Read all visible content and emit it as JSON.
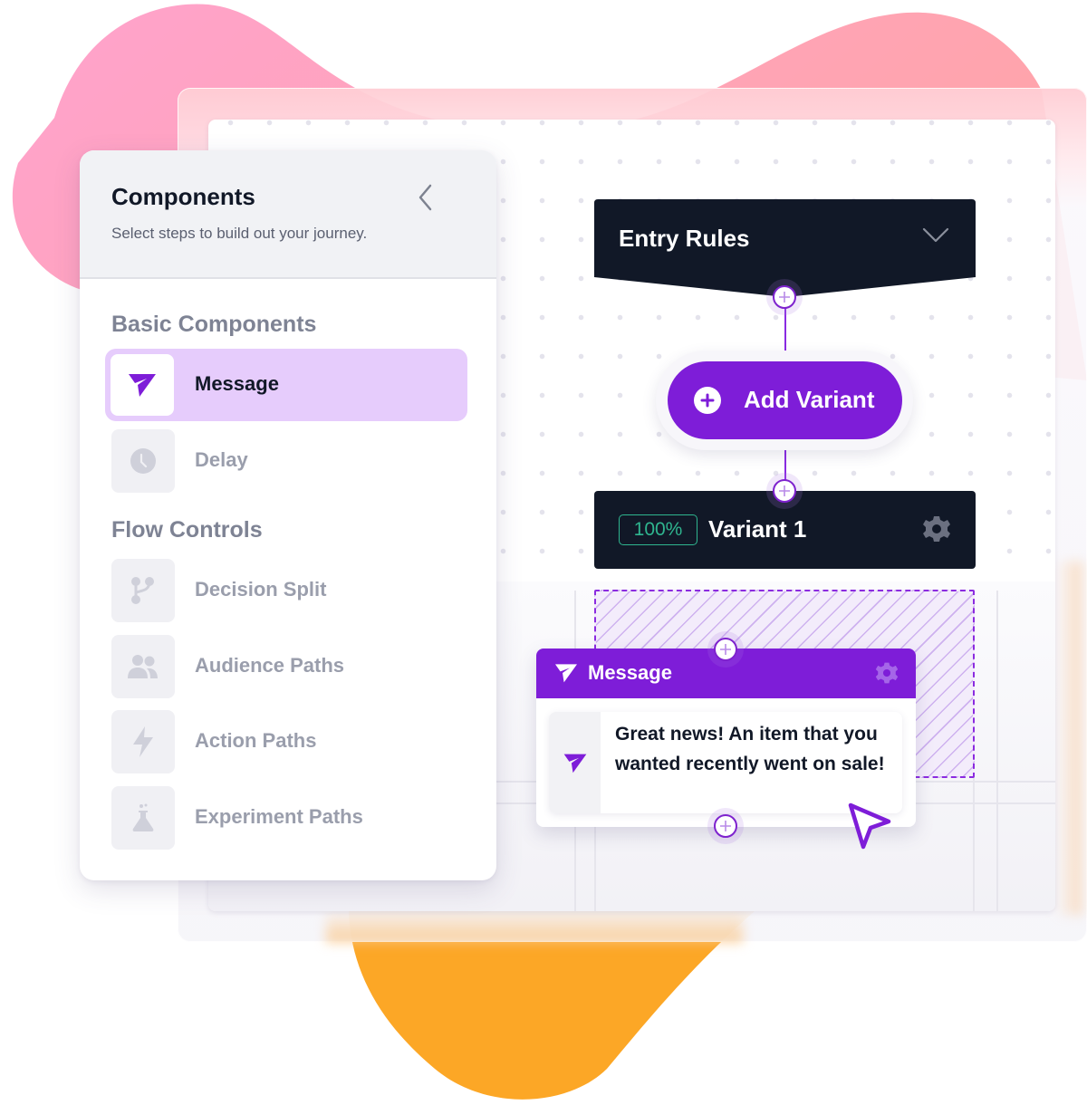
{
  "panel": {
    "title": "Components",
    "subtitle": "Select steps to build out your journey.",
    "collapse_icon": "chevron-left-icon",
    "sections": [
      {
        "title": "Basic Components",
        "items": [
          {
            "label": "Message",
            "icon": "send-icon",
            "active": true
          },
          {
            "label": "Delay",
            "icon": "clock-icon",
            "active": false
          }
        ]
      },
      {
        "title": "Flow Controls",
        "items": [
          {
            "label": "Decision Split",
            "icon": "branch-icon",
            "active": false
          },
          {
            "label": "Audience Paths",
            "icon": "users-icon",
            "active": false
          },
          {
            "label": "Action Paths",
            "icon": "lightning-icon",
            "active": false
          },
          {
            "label": "Experiment Paths",
            "icon": "flask-icon",
            "active": false
          }
        ]
      }
    ]
  },
  "canvas": {
    "entry_rules": {
      "title": "Entry Rules",
      "icon": "chevron-down-icon"
    },
    "add_variant": {
      "label": "Add Variant",
      "icon": "plus-circle-icon"
    },
    "variant": {
      "percent": "100%",
      "title": "Variant 1",
      "icon": "gear-icon"
    },
    "message_card": {
      "title": "Message",
      "text": "Great news! An item that you wanted recently went on sale!",
      "icon": "send-icon",
      "settings_icon": "gear-icon"
    }
  },
  "colors": {
    "accent_purple": "#7e1dd8",
    "active_item_bg": "#e6ccfc",
    "node_dark": "#111827",
    "percent_green": "#2fb58f",
    "blob_pink": "#ffa3c4",
    "blob_orange": "#fca726"
  }
}
